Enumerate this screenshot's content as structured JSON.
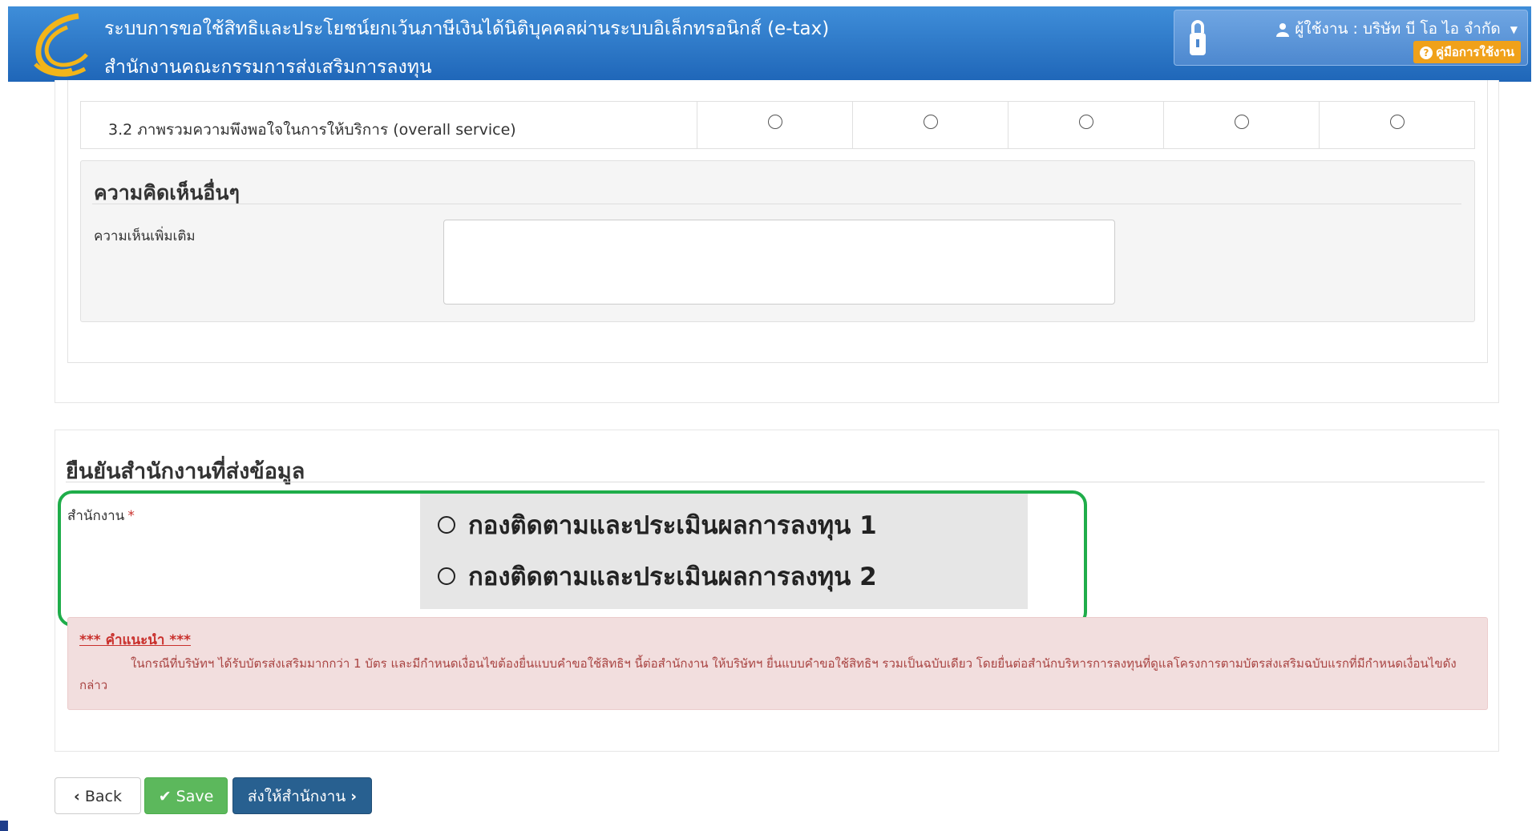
{
  "header": {
    "title": "ระบบการขอใช้สิทธิและประโยชน์ยกเว้นภาษีเงินได้นิติบุคคลผ่านระบบอิเล็กทรอนิกส์ (e-tax)",
    "subtitle": "สำนักงานคณะกรรมการส่งเสริมการลงทุน",
    "user_label": "ผู้ใช้งาน : บริษัท บี โอ ไอ จำกัด",
    "manual_label": "คู่มือการใช้งาน"
  },
  "survey": {
    "row_label": "3.2 ภาพรวมความพึงพอใจในการให้บริการ (overall service)",
    "radio_count": 5
  },
  "comments": {
    "title": "ความคิดเห็นอื่นๆ",
    "label": "ความเห็นเพิ่มเติม",
    "value": ""
  },
  "confirm": {
    "title": "ยืนยันสำนักงานที่ส่งข้อมูล",
    "office_label": "สำนักงาน",
    "required_mark": "*",
    "options": [
      "กองติดตามและประเมินผลการลงทุน 1",
      "กองติดตามและประเมินผลการลงทุน 2"
    ]
  },
  "note": {
    "title": "*** คำแนะนำ ***",
    "text": "ในกรณีที่บริษัทฯ ได้รับบัตรส่งเสริมมากกว่า 1 บัตร และมีกำหนดเงื่อนไขต้องยื่นแบบคำขอใช้สิทธิฯ นี้ต่อสำนักงาน ให้บริษัทฯ ยื่นแบบคำขอใช้สิทธิฯ รวมเป็นฉบับเดียว โดยยื่นต่อสำนักบริหารการลงทุนที่ดูแลโครงการตามบัตรส่งเสริมฉบับแรกที่มีกำหนดเงื่อนไขดังกล่าว"
  },
  "buttons": {
    "back": "Back",
    "save": "Save",
    "send": "ส่งให้สำนักงาน"
  },
  "colors": {
    "header_blue": "#1f66b8",
    "highlight_green": "#1fad4a",
    "save_green": "#5cb85c",
    "send_blue": "#286090",
    "manual_orange": "#f0a11a"
  },
  "icons": [
    "boi-logo-icon",
    "lock-icon",
    "user-icon",
    "caret-down-icon",
    "question-circle-icon",
    "chevron-left-icon",
    "check-icon",
    "chevron-right-icon"
  ]
}
